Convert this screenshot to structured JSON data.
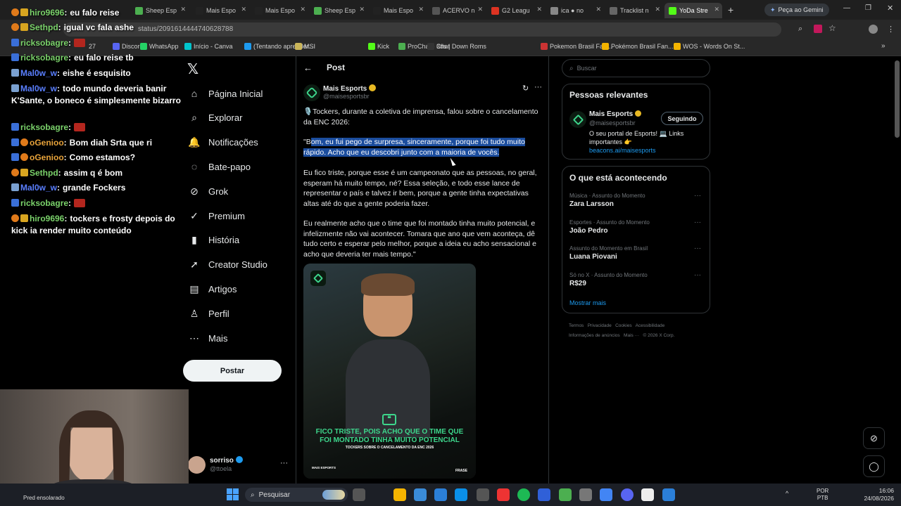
{
  "browser": {
    "tabs": [
      {
        "label": "Sheep Esp",
        "color": "#4caf50"
      },
      {
        "label": "Mais Espo",
        "color": "#222"
      },
      {
        "label": "Mais Espo",
        "color": "#222"
      },
      {
        "label": "Sheep Esp",
        "color": "#4caf50"
      },
      {
        "label": "Mais Espo",
        "color": "#222"
      },
      {
        "label": "ACERVO n",
        "color": "#555"
      },
      {
        "label": "G2 Leagu",
        "color": "#d32"
      },
      {
        "label": "ica ● no",
        "color": "#888"
      },
      {
        "label": "Tracklist n",
        "color": "#666"
      },
      {
        "label": "YoDa Stre",
        "color": "#53fc18"
      }
    ],
    "gemini_button": "Peça ao Gemini",
    "url": "status/2091614444740628788",
    "bookmarks": [
      "Discord",
      "WhatsApp",
      "Início - Canva",
      "(Tentando aprender...",
      "MSI",
      "Kick",
      "ProChat - Chat",
      "3ds | Down Roms",
      "Pokemon Brasil Fan...",
      "Pokémon Brasil Fan...",
      "WOS - Words On St..."
    ],
    "bookmark_count": "27"
  },
  "chat": [
    {
      "name": "hiro9696",
      "color": "#7bd36b",
      "badges": [
        "b2",
        "b3"
      ],
      "text": "eu falo reise"
    },
    {
      "name": "Sethpd",
      "color": "#7bd36b",
      "badges": [
        "b2",
        "b3"
      ],
      "text": "igual vc fala ashe"
    },
    {
      "name": "ricksobagre",
      "color": "#7bd36b",
      "badges": [
        "b1"
      ],
      "text": ""
    },
    {
      "name": "ricksobagre",
      "color": "#7bd36b",
      "badges": [
        "b1"
      ],
      "text": "eu falo reise tb"
    },
    {
      "name": "Mal0w_w",
      "color": "#5a7fff",
      "badges": [
        "b4"
      ],
      "text": "eishe é esquisito"
    },
    {
      "name": "Mal0w_w",
      "color": "#5a7fff",
      "badges": [
        "b4"
      ],
      "text": "todo mundo deveria banir K'Sante, o boneco é simplesmente bizarro"
    },
    {
      "name": "ricksobagre",
      "color": "#7bd36b",
      "badges": [
        "b1"
      ],
      "text": ""
    },
    {
      "name": "oGenioo",
      "color": "#e8a33a",
      "badges": [
        "b1",
        "b2"
      ],
      "text": "Bom diah Srta que ri"
    },
    {
      "name": "oGenioo",
      "color": "#e8a33a",
      "badges": [
        "b1",
        "b2"
      ],
      "text": "Como estamos?"
    },
    {
      "name": "Sethpd",
      "color": "#7bd36b",
      "badges": [
        "b2",
        "b3"
      ],
      "text": "assim q é bom"
    },
    {
      "name": "Mal0w_w",
      "color": "#5a7fff",
      "badges": [
        "b4"
      ],
      "text": "grande Fockers"
    },
    {
      "name": "ricksobagre",
      "color": "#7bd36b",
      "badges": [
        "b1"
      ],
      "text": ""
    },
    {
      "name": "hiro9696",
      "color": "#7bd36b",
      "badges": [
        "b2",
        "b3"
      ],
      "text": "tockers e frosty depois do kick ia render muito conteúdo"
    }
  ],
  "nav": {
    "items": [
      "Página Inicial",
      "Explorar",
      "Notificações",
      "Bate-papo",
      "Grok",
      "Premium",
      "História",
      "Creator Studio",
      "Artigos",
      "Perfil",
      "Mais"
    ],
    "post_button": "Postar",
    "account_name": "sorriso",
    "account_handle": "@ttoela"
  },
  "post": {
    "header": "Post",
    "author": "Mais Esports",
    "handle": "@maisesportsbr",
    "p1": "🎙️Tockers, durante a coletiva de imprensa, falou sobre o cancelamento da ENC 2026:",
    "p2_pre": "\"B",
    "p2_hl": "om, eu fui pego de surpresa, sinceramente, porque foi tudo muito rápido. Acho que eu descobri junto com a maioria de vocês.",
    "p3": "Eu fico triste, porque esse é um campeonato que as pessoas, no geral, esperam há muito tempo, né? Essa seleção, e todo esse lance de representar o país e talvez ir bem, porque a gente tinha expectativas altas até do que a gente poderia fazer.",
    "p4": "Eu realmente acho que o time que foi montado tinha muito potencial, e infelizmente não vai acontecer. Tomara que ano que vem aconteça, dê tudo certo e esperar pelo melhor, porque a ideia eu acho sensacional e acho que deveria ter mais tempo.\"",
    "image_quote": "FICO TRISTE, POIS ACHO QUE O TIME QUE FOI MONTADO TINHA MUITO POTENCIAL",
    "image_sub": "TOCKERS SOBRE O CANCELAMENTO DA ENC 2026",
    "image_brand": "MAIS ESPORTS",
    "image_tag": "FRASE"
  },
  "right": {
    "search_placeholder": "Buscar",
    "relevant_title": "Pessoas relevantes",
    "rel_name": "Mais Esports",
    "rel_handle": "@maisesportsbr",
    "rel_button": "Seguindo",
    "rel_bio": "O seu portal de Esports! 💻 Links importantes 👉",
    "rel_link": "beacons.ai/maisesports",
    "trending_title": "O que está acontecendo",
    "trends": [
      {
        "cat": "Música · Assunto do Momento",
        "name": "Zara Larsson"
      },
      {
        "cat": "Esportes · Assunto do Momento",
        "name": "João Pedro"
      },
      {
        "cat": "Assunto do Momento em Brasil",
        "name": "Luana Piovani"
      },
      {
        "cat": "Só no X · Assunto do Momento",
        "name": "R$29"
      }
    ],
    "show_more": "Mostrar mais",
    "footer1": "Termos   Privacidade   Cookies   Acessibilidade",
    "footer2": "Informações de anúncios   Mais ···   © 2026 X Corp."
  },
  "taskbar": {
    "search": "Pesquisar",
    "weather": "Pred ensolarado",
    "lang": "POR",
    "lang2": "PTB",
    "time": "16:06",
    "date": "24/08/2026"
  }
}
